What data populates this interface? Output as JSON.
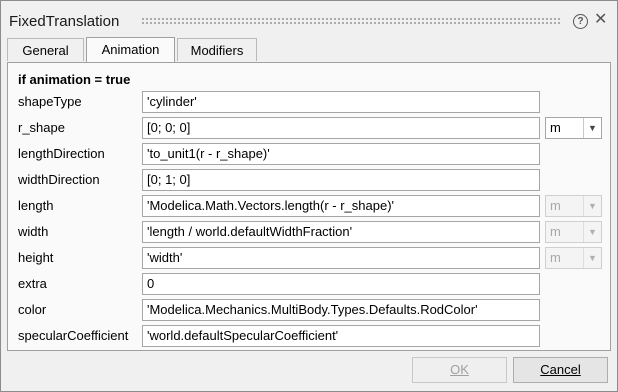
{
  "window": {
    "title": "FixedTranslation",
    "help_icon": "help-icon",
    "close_icon": "close-icon"
  },
  "tabs": [
    {
      "label": "General",
      "active": false
    },
    {
      "label": "Animation",
      "active": true
    },
    {
      "label": "Modifiers",
      "active": false
    }
  ],
  "section": {
    "title": "if animation = true"
  },
  "parameters": [
    {
      "label": "shapeType",
      "value": "'cylinder'"
    },
    {
      "label": "r_shape",
      "value": "[0; 0; 0]",
      "unit": "m",
      "unit_enabled": true
    },
    {
      "label": "lengthDirection",
      "value": "'to_unit1(r - r_shape)'"
    },
    {
      "label": "widthDirection",
      "value": "[0; 1; 0]"
    },
    {
      "label": "length",
      "value": "'Modelica.Math.Vectors.length(r - r_shape)'",
      "unit": "m",
      "unit_enabled": false
    },
    {
      "label": "width",
      "value": "'length / world.defaultWidthFraction'",
      "unit": "m",
      "unit_enabled": false
    },
    {
      "label": "height",
      "value": "'width'",
      "unit": "m",
      "unit_enabled": false
    },
    {
      "label": "extra",
      "value": "0"
    },
    {
      "label": "color",
      "value": "'Modelica.Mechanics.MultiBody.Types.Defaults.RodColor'"
    },
    {
      "label": "specularCoefficient",
      "value": "'world.defaultSpecularCoefficient'"
    }
  ],
  "buttons": {
    "ok_label": "OK",
    "ok_enabled": false,
    "cancel_label": "Cancel"
  }
}
